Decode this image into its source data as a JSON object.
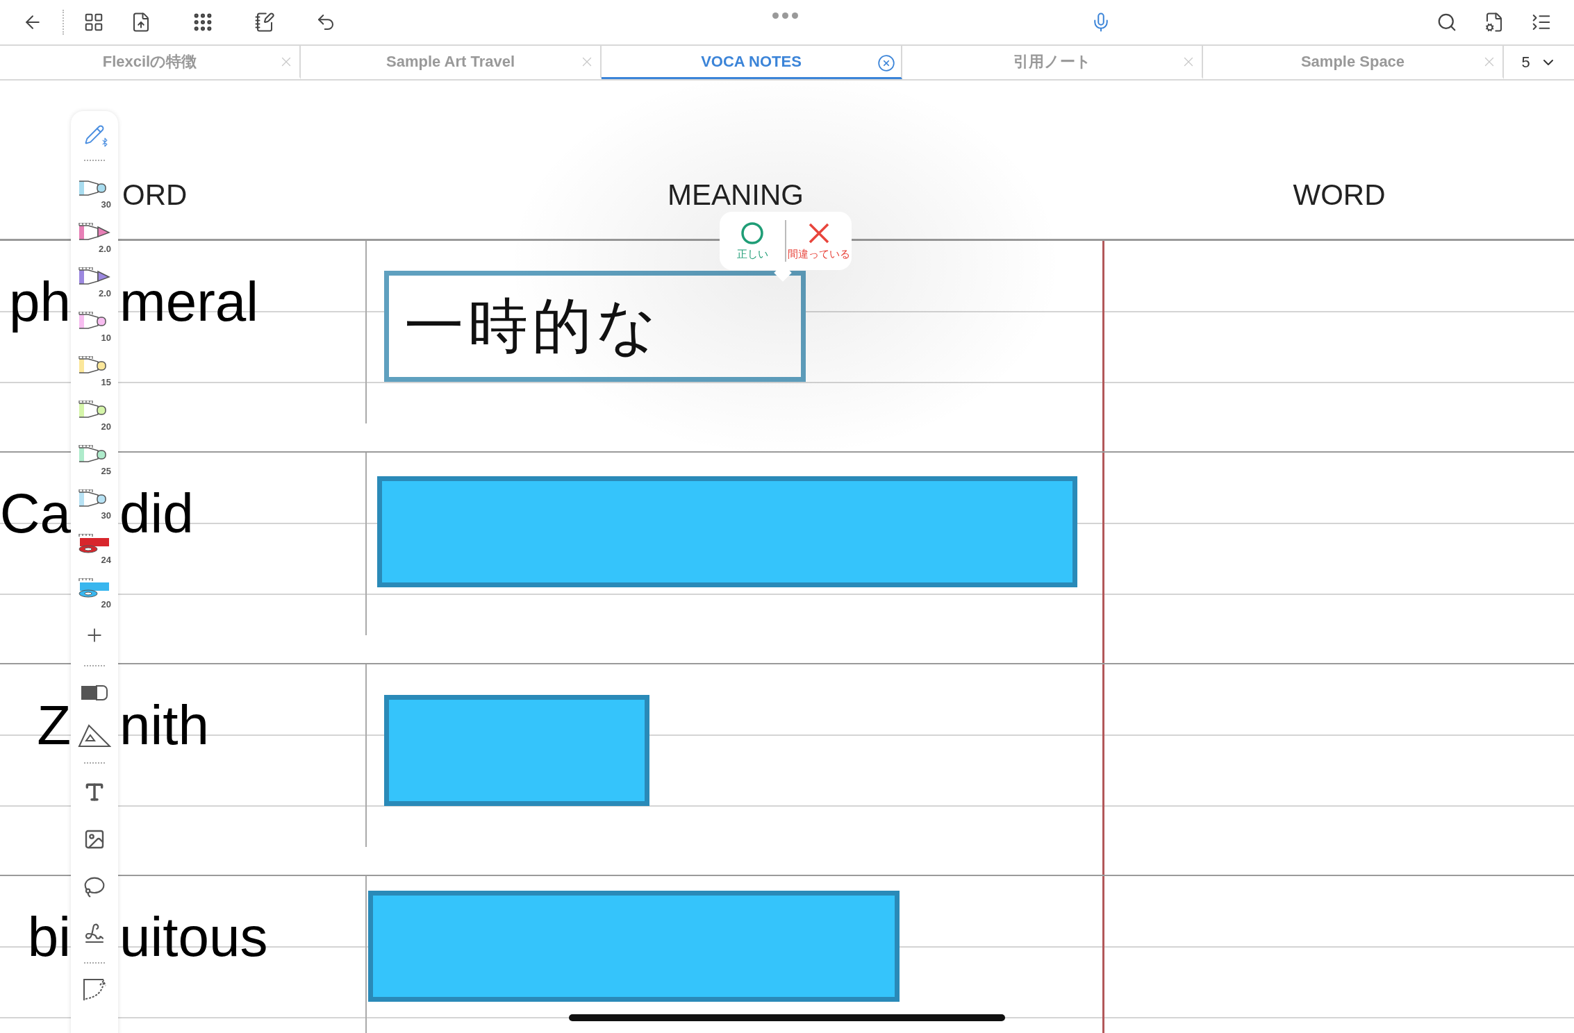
{
  "tabs": [
    {
      "label": "Flexcilの特徴",
      "selected": false
    },
    {
      "label": "Sample Art Travel",
      "selected": false
    },
    {
      "label": "VOCA NOTES",
      "selected": true
    },
    {
      "label": "引用ノート",
      "selected": false
    },
    {
      "label": "Sample Space",
      "selected": false
    }
  ],
  "tab_count": "5",
  "pen_tools": [
    {
      "kind": "marker",
      "color": "#a8dcef",
      "size": "30",
      "ruler": false
    },
    {
      "kind": "fine",
      "color": "#e77fb6",
      "size": "2.0",
      "ruler": true
    },
    {
      "kind": "fine",
      "color": "#9c88e0",
      "size": "2.0",
      "ruler": true
    },
    {
      "kind": "marker",
      "color": "#f7bdf0",
      "size": "10",
      "ruler": true
    },
    {
      "kind": "marker",
      "color": "#fbe79a",
      "size": "15",
      "ruler": true
    },
    {
      "kind": "marker",
      "color": "#d5f5a9",
      "size": "20",
      "ruler": true
    },
    {
      "kind": "marker",
      "color": "#aeebcb",
      "size": "25",
      "ruler": true
    },
    {
      "kind": "marker",
      "color": "#b7e2f4",
      "size": "30",
      "ruler": true
    },
    {
      "kind": "tape",
      "color": "#d8262c",
      "size": "24",
      "ruler": true
    },
    {
      "kind": "tape",
      "color": "#39b6ee",
      "size": "20",
      "ruler": true
    }
  ],
  "notebook": {
    "columns": [
      {
        "heading": "ORD"
      },
      {
        "heading": "MEANING"
      },
      {
        "heading": "WORD"
      }
    ],
    "rows": [
      {
        "word_parts": [
          "ph",
          "meral"
        ],
        "answer": {
          "kind": "revealed",
          "text": "一時的な"
        }
      },
      {
        "word_parts": [
          "Ca",
          "did"
        ],
        "answer": {
          "kind": "masked"
        }
      },
      {
        "word_parts": [
          "Z",
          "nith"
        ],
        "answer": {
          "kind": "masked"
        }
      },
      {
        "word_parts": [
          "bi",
          "uitous"
        ],
        "answer": {
          "kind": "masked"
        }
      }
    ]
  },
  "grade_popup": {
    "options": [
      {
        "kind": "correct",
        "label": "正しい"
      },
      {
        "kind": "wrong",
        "label": "間違っている"
      }
    ]
  }
}
